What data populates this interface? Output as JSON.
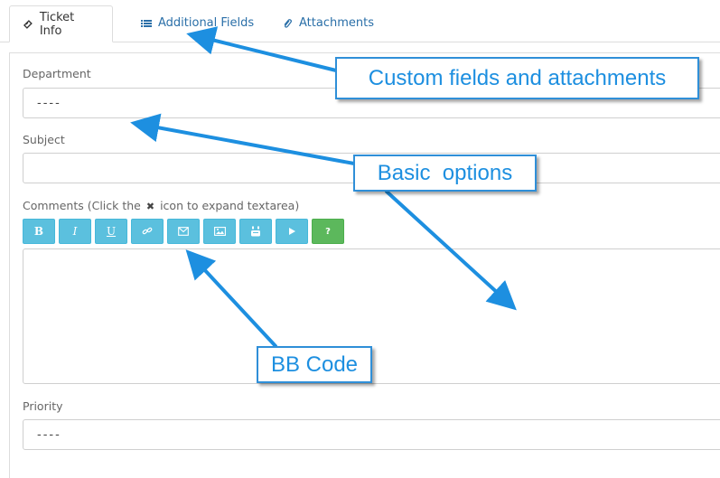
{
  "tabs": [
    {
      "label": "Ticket Info",
      "icon": "ticket-icon",
      "active": true
    },
    {
      "label": "Additional Fields",
      "icon": "list-icon",
      "active": false
    },
    {
      "label": "Attachments",
      "icon": "paperclip-icon",
      "active": false
    }
  ],
  "form": {
    "department_label": "Department",
    "department_value": "----",
    "subject_label": "Subject",
    "subject_value": "",
    "comments_label_pre": "Comments (Click the",
    "comments_label_post": "icon to expand textarea)",
    "comments_value": "",
    "priority_label": "Priority",
    "priority_value": "----"
  },
  "bbcode_buttons": [
    {
      "name": "bold",
      "label": "B"
    },
    {
      "name": "italic",
      "label": "I"
    },
    {
      "name": "underline",
      "label": "U"
    },
    {
      "name": "link",
      "label": "link-icon"
    },
    {
      "name": "email",
      "label": "envelope-icon"
    },
    {
      "name": "image",
      "label": "picture-icon"
    },
    {
      "name": "youtube",
      "label": "youtube-icon"
    },
    {
      "name": "video",
      "label": "play-icon"
    },
    {
      "name": "help",
      "label": "?"
    }
  ],
  "callouts": {
    "custom": "Custom fields and attachments",
    "basic": "Basic  options",
    "bbcode": "BB Code"
  },
  "colors": {
    "accent": "#2f8fd8",
    "bb_button": "#5bc0de",
    "help_button": "#5cb85c",
    "tab_link": "#2a6fa8"
  }
}
